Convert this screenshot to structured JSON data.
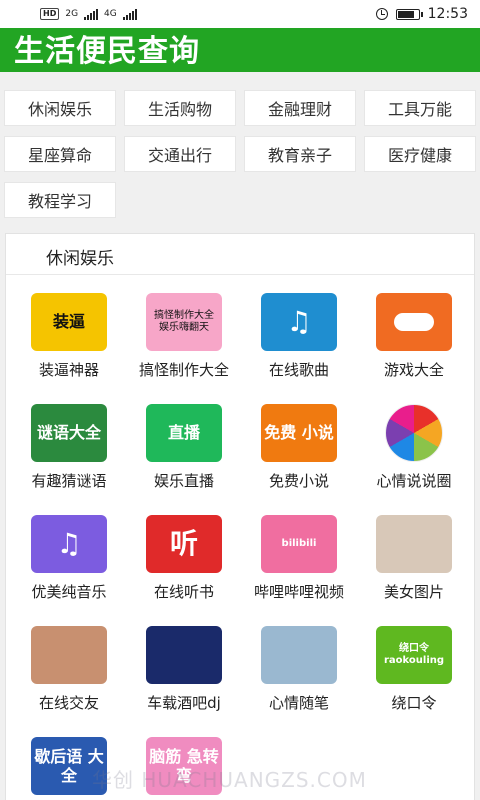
{
  "status_bar": {
    "network_badge": "HD",
    "network_1": "2G",
    "network_2": "4G",
    "time": "12:53"
  },
  "header": {
    "title": "生活便民查询"
  },
  "categories": [
    {
      "label": "休闲娱乐"
    },
    {
      "label": "生活购物"
    },
    {
      "label": "金融理财"
    },
    {
      "label": "工具万能"
    },
    {
      "label": "星座算命"
    },
    {
      "label": "交通出行"
    },
    {
      "label": "教育亲子"
    },
    {
      "label": "医疗健康"
    },
    {
      "label": "教程学习"
    }
  ],
  "section": {
    "title": "休闲娱乐"
  },
  "apps": [
    {
      "label": "装逼神器",
      "icon": "sunglasses-face-icon",
      "icon_text": "装逼",
      "color": "#f5c400"
    },
    {
      "label": "搞怪制作大全",
      "icon": "meme-maker-icon",
      "icon_text": "搞怪制作大全 娱乐嗨翻天",
      "color": "#f7a6c8"
    },
    {
      "label": "在线歌曲",
      "icon": "music-note-icon",
      "icon_text": "♫",
      "color": "#1f8ed0"
    },
    {
      "label": "游戏大全",
      "icon": "gamepad-icon",
      "icon_text": "",
      "color": "#f06b22"
    },
    {
      "label": "有趣猜谜语",
      "icon": "riddle-icon",
      "icon_text": "谜语大全",
      "color": "#2b8a3e"
    },
    {
      "label": "娱乐直播",
      "icon": "live-stream-icon",
      "icon_text": "直播",
      "color": "#1fb85a"
    },
    {
      "label": "免费小说",
      "icon": "book-icon",
      "icon_text": "免费 小说",
      "color": "#f07a10"
    },
    {
      "label": "心情说说圈",
      "icon": "aperture-icon",
      "icon_text": "",
      "color": "#ffffff"
    },
    {
      "label": "优美纯音乐",
      "icon": "music-note-icon",
      "icon_text": "♫",
      "color": "#7c5ce0"
    },
    {
      "label": "在线听书",
      "icon": "headphones-book-icon",
      "icon_text": "听",
      "color": "#e02a2a"
    },
    {
      "label": "哔哩哔哩视频",
      "icon": "bilibili-icon",
      "icon_text": "bilibili",
      "color": "#f06ea0"
    },
    {
      "label": "美女图片",
      "icon": "photo-portrait-icon",
      "icon_text": "",
      "color": "#d8c8b8"
    },
    {
      "label": "在线交友",
      "icon": "photo-portrait-icon",
      "icon_text": "",
      "color": "#c89070"
    },
    {
      "label": "车载酒吧dj",
      "icon": "dj-turntable-icon",
      "icon_text": "",
      "color": "#1a2a6a"
    },
    {
      "label": "心情随笔",
      "icon": "notebook-photo-icon",
      "icon_text": "",
      "color": "#9ab8d0"
    },
    {
      "label": "绕口令",
      "icon": "tongue-twister-icon",
      "icon_text": "绕口令 raokouling",
      "color": "#5fb820"
    },
    {
      "label": "",
      "icon": "book-icon",
      "icon_text": "歇后语 大全",
      "color": "#2a5ab0"
    },
    {
      "label": "",
      "icon": "brain-teaser-icon",
      "icon_text": "脑筋 急转弯",
      "color": "#f08cc0"
    }
  ],
  "watermark": "华创 HUACHUANGZS.COM"
}
